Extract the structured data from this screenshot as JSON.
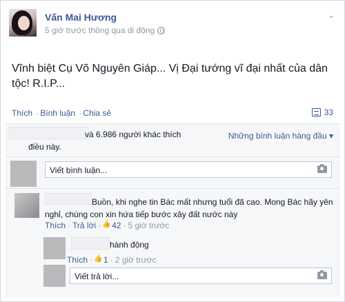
{
  "post": {
    "author": "Vấn Mai Hương",
    "meta": "5 giờ trước thông qua di động",
    "text": "Vĩnh biệt Cụ Võ Nguyên Giáp... Vị Đại tướng vĩ đại nhất của dân tộc! R.I.P..."
  },
  "actions": {
    "like": "Thích",
    "comment": "Bình luận",
    "share": "Chia sẻ",
    "comment_count": "33"
  },
  "likes": {
    "line1": "và 6.986 người khác thích",
    "line2": "điều này.",
    "top_comments": "Những bình luận hàng đầu ▾"
  },
  "composer": {
    "placeholder": "Viết bình luận..."
  },
  "comment1": {
    "text": "Buồn, khi nghe tin Bác mất nhưng tuổi đã cao. Mong Bác hãy yên nghỉ, chúng con xin hứa tiếp bước xây đất nước này",
    "like": "Thích",
    "reply": "Trả lời",
    "like_count": "42",
    "time": "5 giờ trước"
  },
  "reply1": {
    "text": "hành động",
    "like": "Thích",
    "like_count": "1",
    "time": "2 giờ trước"
  },
  "reply_composer": {
    "placeholder": "Viết trả lời..."
  },
  "icons": [
    "chevron-down-icon",
    "globe-icon",
    "comment-count-icon",
    "camera-icon",
    "thumbs-up-icon"
  ]
}
